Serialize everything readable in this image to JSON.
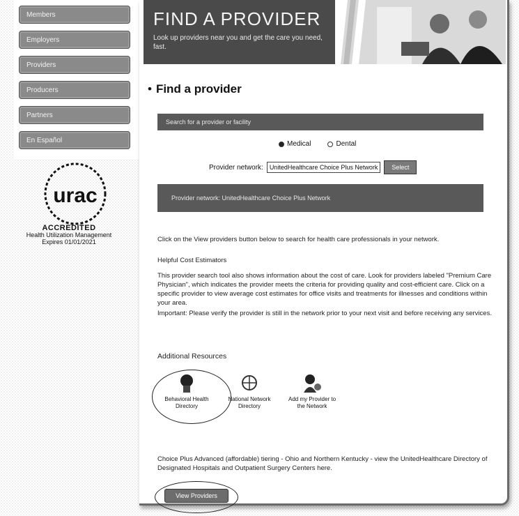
{
  "sidebar": {
    "items": [
      {
        "label": "Members"
      },
      {
        "label": "Employers"
      },
      {
        "label": "Providers"
      },
      {
        "label": "Producers"
      },
      {
        "label": "Partners"
      },
      {
        "label": "En Español"
      }
    ],
    "urac": {
      "logo_text": "urac",
      "accredited": "ACCREDITED",
      "line1": "Health Utilization Management",
      "line2": "Expires 01/01/2021"
    }
  },
  "banner": {
    "title": "FIND A PROVIDER",
    "subtitle": "Look up providers near you and get the care you need, fast."
  },
  "main": {
    "heading": "Find a provider",
    "search_bar_label": "Search for a provider or facility",
    "radio_options": [
      {
        "label": "Medical",
        "selected": true
      },
      {
        "label": "Dental",
        "selected": false
      }
    ],
    "network_label": "Provider network:",
    "network_value": "UnitedHealthcare Choice Plus Network",
    "go_label": "Select",
    "result_bar": "Provider network: UnitedHealthcare Choice Plus Network",
    "intro": "Click on the View providers button below to search for health care professionals in your network.",
    "helpful_title": "Helpful Cost Estimators",
    "body": "This provider search tool also shows information about the cost of care. Look for providers labeled \"Premium Care Physician\", which indicates the provider meets the criteria for providing quality and cost-efficient care. Click on a specific provider to view average cost estimates for office visits and treatments for illnesses and conditions within your area.",
    "important": "Important: Please verify the provider is still in the network prior to your next visit and before receiving any services.",
    "resources_title": "Additional Resources",
    "resources": [
      {
        "label": "Behavioral Health Directory",
        "icon": "person-head-icon"
      },
      {
        "label": "National Network Directory",
        "icon": "globe-network-icon"
      },
      {
        "label": "Add my Provider to the Network",
        "icon": "person-add-icon"
      }
    ],
    "footer_text": "Choice Plus Advanced (affordable) tiering - Ohio and Northern Kentucky - view the UnitedHealthcare Directory of Designated Hospitals and Outpatient Surgery Centers here.",
    "view_button": "View Providers"
  }
}
